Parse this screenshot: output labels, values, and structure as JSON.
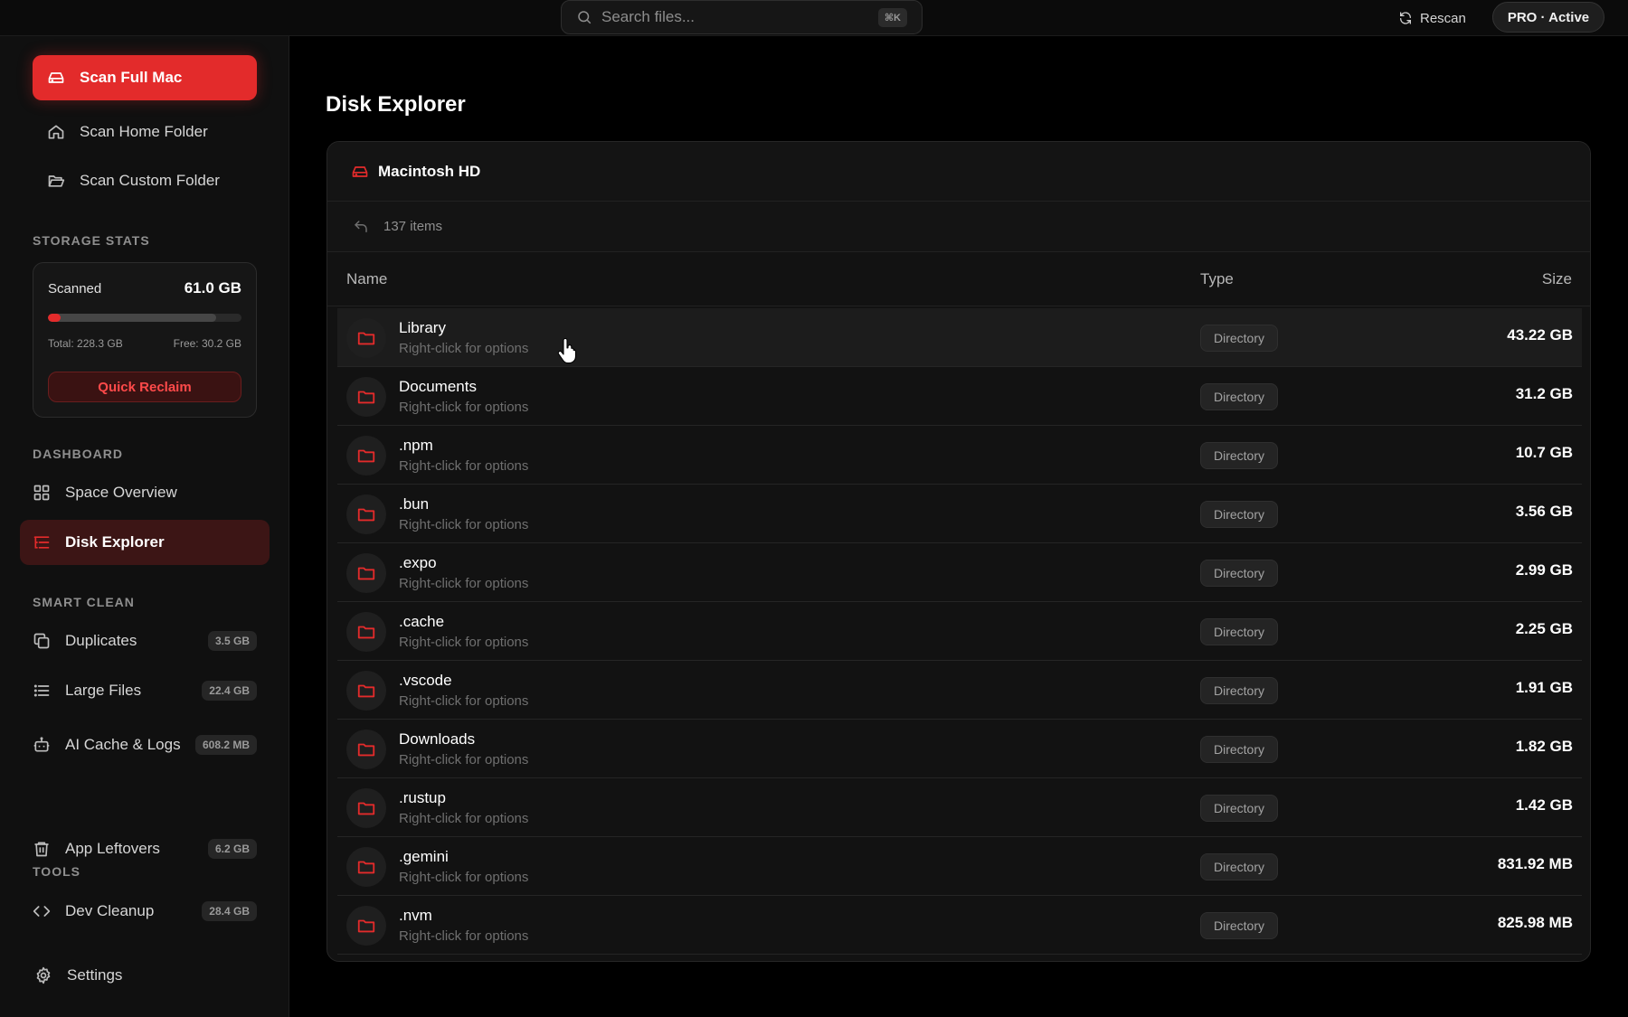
{
  "colors": {
    "accent": "#e32b2b",
    "background": "#000000",
    "sidebar": "#101010",
    "panel": "#121212"
  },
  "topbar": {
    "search_placeholder": "Search files...",
    "search_shortcut": "⌘K",
    "rescan_label": "Rescan",
    "pro_label": "PRO · Active"
  },
  "sidebar": {
    "scan_full_label": "Scan Full Mac",
    "scan_home_label": "Scan Home Folder",
    "scan_custom_label": "Scan Custom Folder",
    "storage_section": "STORAGE STATS",
    "stats": {
      "scanned_label": "Scanned",
      "scanned_value": "61.0 GB",
      "total": "Total: 228.3 GB",
      "free": "Free: 30.2 GB",
      "scanned_fraction": 0.0672,
      "used_fraction": 0.868,
      "reclaim_label": "Quick Reclaim"
    },
    "dashboard_section": "DASHBOARD",
    "space_overview_label": "Space Overview",
    "disk_explorer_label": "Disk Explorer",
    "smart_clean_section": "SMART CLEAN",
    "duplicates_label": "Duplicates",
    "duplicates_badge": "3.5 GB",
    "large_files_label": "Large Files",
    "large_files_badge": "22.4 GB",
    "ai_cache_label": "AI Cache & Logs",
    "ai_cache_badge": "608.2 MB",
    "app_leftovers_label": "App Leftovers",
    "app_leftovers_badge": "6.2 GB",
    "tools_section": "TOOLS",
    "dev_cleanup_label": "Dev Cleanup",
    "dev_cleanup_badge": "28.4 GB",
    "settings_label": "Settings"
  },
  "main": {
    "title": "Disk Explorer",
    "volume_name": "Macintosh HD",
    "item_count": "137 items",
    "columns": {
      "name": "Name",
      "type": "Type",
      "size": "Size"
    },
    "rows": [
      {
        "name": "Library",
        "hint": "Right-click for options",
        "type": "Directory",
        "size": "43.22 GB"
      },
      {
        "name": "Documents",
        "hint": "Right-click for options",
        "type": "Directory",
        "size": "31.2 GB"
      },
      {
        "name": ".npm",
        "hint": "Right-click for options",
        "type": "Directory",
        "size": "10.7 GB"
      },
      {
        "name": ".bun",
        "hint": "Right-click for options",
        "type": "Directory",
        "size": "3.56 GB"
      },
      {
        "name": ".expo",
        "hint": "Right-click for options",
        "type": "Directory",
        "size": "2.99 GB"
      },
      {
        "name": ".cache",
        "hint": "Right-click for options",
        "type": "Directory",
        "size": "2.25 GB"
      },
      {
        "name": ".vscode",
        "hint": "Right-click for options",
        "type": "Directory",
        "size": "1.91 GB"
      },
      {
        "name": "Downloads",
        "hint": "Right-click for options",
        "type": "Directory",
        "size": "1.82 GB"
      },
      {
        "name": ".rustup",
        "hint": "Right-click for options",
        "type": "Directory",
        "size": "1.42 GB"
      },
      {
        "name": ".gemini",
        "hint": "Right-click for options",
        "type": "Directory",
        "size": "831.92 MB"
      },
      {
        "name": ".nvm",
        "hint": "Right-click for options",
        "type": "Directory",
        "size": "825.98 MB"
      }
    ]
  }
}
